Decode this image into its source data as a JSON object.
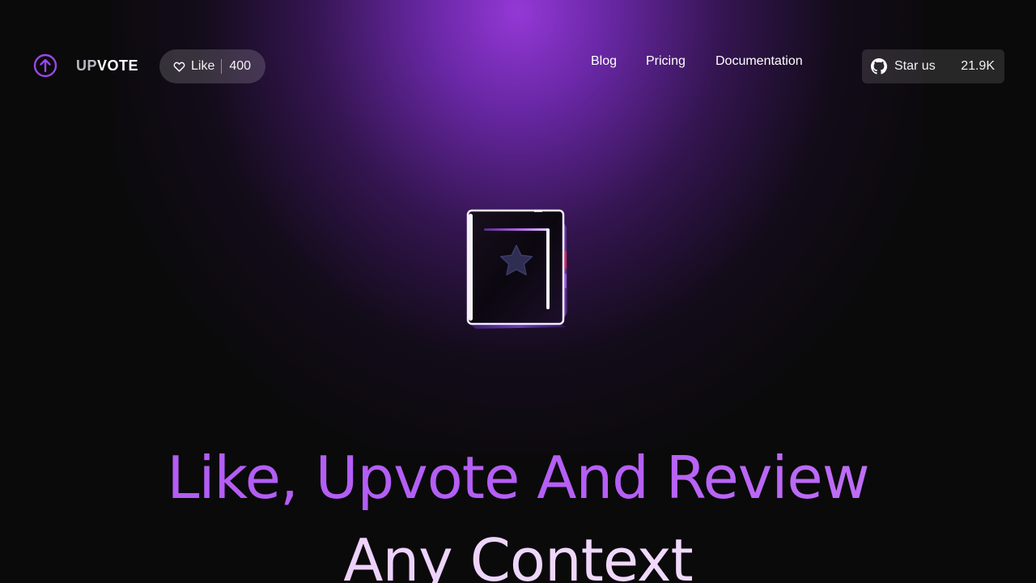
{
  "header": {
    "brand_prefix": "UP",
    "brand_suffix": "VOTE",
    "logo_icon": "arrow-up-circle-icon",
    "like": {
      "icon": "heart-outline-icon",
      "label": "Like",
      "count": "400"
    },
    "nav": [
      {
        "label": "Blog"
      },
      {
        "label": "Pricing"
      },
      {
        "label": "Documentation"
      }
    ],
    "star": {
      "icon": "github-icon",
      "label": "Star us",
      "count": "21.9K"
    }
  },
  "hero": {
    "illustration_icon": "star-cube-icon",
    "headline_line1": "Like, Upvote And Review",
    "headline_line2": "Any Context"
  },
  "colors": {
    "background": "#0a0a0a",
    "glow": "#9438d6",
    "accent": "#b15cf4",
    "logo_stroke": "#9a48e8",
    "headline_light": "#f0dcfc"
  }
}
